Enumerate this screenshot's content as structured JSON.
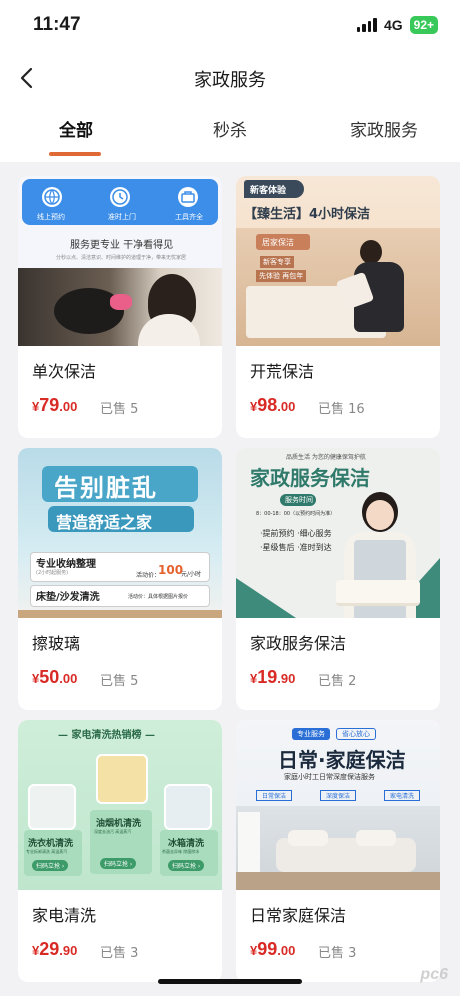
{
  "status_bar": {
    "time": "11:47",
    "network": "4G",
    "battery": "92+"
  },
  "nav": {
    "title": "家政服务",
    "back_icon": "chevron-left-icon"
  },
  "tabs": [
    {
      "label": "全部",
      "active": true
    },
    {
      "label": "秒杀",
      "active": false
    },
    {
      "label": "家政服务",
      "active": false
    }
  ],
  "colors": {
    "accent": "#e06a35",
    "price": "#d92b26",
    "background": "#f2f2f4"
  },
  "products": [
    {
      "name": "单次保洁",
      "price_symbol": "¥",
      "price_int": "79",
      "price_dec": ".00",
      "sold": "已售 5",
      "image_text": {
        "icons": [
          "线上预约",
          "准时上门",
          "工具齐全"
        ],
        "headline": "服务更专业 干净看得见",
        "sub": "分秒以点、清洁意识、时间维护的道理于净，带来无忧家居"
      }
    },
    {
      "name": "开荒保洁",
      "price_symbol": "¥",
      "price_int": "98",
      "price_dec": ".00",
      "sold": "已售 16",
      "image_text": {
        "badge": "新客体验",
        "title": "【臻生活】4小时保洁",
        "tag1": "居家保洁",
        "tag2": "新客专享",
        "tag3": "先体验 再包年"
      }
    },
    {
      "name": "擦玻璃",
      "price_symbol": "¥",
      "price_int": "50",
      "price_dec": ".00",
      "sold": "已售 5",
      "image_text": {
        "line1": "告别脏乱",
        "line2": "营造舒适之家",
        "row1": "专业收纳整理",
        "row1_sub": "(2小时起服务)",
        "row1_price_label": "活动价：",
        "row1_price": "100",
        "row1_unit": "元/小时",
        "row2": "床垫/沙发清洗",
        "row2_price": "活动价：具体根据图片报价"
      }
    },
    {
      "name": "家政服务保洁",
      "price_symbol": "¥",
      "price_int": "19",
      "price_dec": ".90",
      "sold": "已售 2",
      "image_text": {
        "top": "品质生活 为您的健康保驾护航",
        "title": "家政服务保洁",
        "badge": "服务时间",
        "hours": "8：00-18：00（以预约时间为准）",
        "b1": "·提前预约 ·细心服务",
        "b2": "·星级售后 ·准时到达"
      }
    },
    {
      "name": "家电清洗",
      "price_symbol": "¥",
      "price_int": "29",
      "price_dec": ".90",
      "sold": "已售 3",
      "image_text": {
        "title": "— 家电清洗热销榜 —",
        "i1": "洗衣机清洗",
        "i1_sub": "专业拆卸清洗 高温蒸汽",
        "i2": "油烟机清洗",
        "i2_sub": "深度去油污 高温蒸汽",
        "i3": "冰箱清洗",
        "i3_sub": "杀菌去异味 除菌除冰",
        "btn": "扫码立抢 ›"
      }
    },
    {
      "name": "日常家庭保洁",
      "price_symbol": "¥",
      "price_int": "99",
      "price_dec": ".00",
      "sold": "已售 3",
      "image_text": {
        "tag1": "专业服务",
        "tag2": "省心放心",
        "title": "日常·家庭保洁",
        "sub": "家庭小时工日常深度保洁服务",
        "c1": "日常保洁",
        "c2": "深度保洁",
        "c3": "家电清洗"
      }
    }
  ],
  "watermark": "pc6"
}
